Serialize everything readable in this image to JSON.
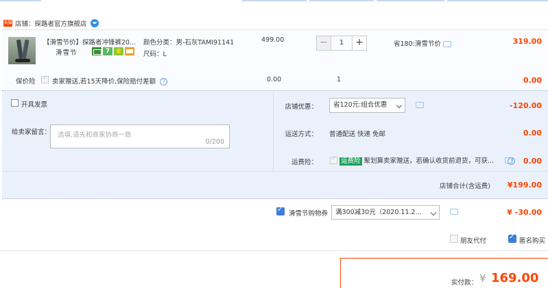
{
  "shop": {
    "badge": "天猫",
    "label": "店铺：探路者官方旗舰店"
  },
  "item": {
    "title": "【滑雪节价】探路者冲锋裤20...",
    "promo": "滑雪节",
    "spec_color": "颜色分类：男-石灰TAMI91141",
    "spec_size": "尺码：L",
    "unit_price": "499.00",
    "quantity": "1",
    "discount_note": "省180:滑雪节价",
    "subtotal": "319.00",
    "icons": [
      "card-icon",
      "seven-day-return-icon",
      "gold-badge-icon",
      "wallet-icon"
    ]
  },
  "insurance": {
    "label": "保价险",
    "text": "卖家赠送,若15天降价,保险赔付差额",
    "price": "0.00",
    "qty": "1",
    "total": "0.00"
  },
  "invoice": {
    "label": "开具发票"
  },
  "message": {
    "label": "给卖家留言：",
    "placeholder": "选填,请先和商家协商一致",
    "count": "0/200"
  },
  "shop_discount": {
    "label": "店铺优惠：",
    "selected": "省120元:组合优惠",
    "amount": "-120.00"
  },
  "shipping": {
    "label": "运送方式：",
    "value": "普通配送 快递 免邮",
    "amount": "0.00"
  },
  "shipping_insurance": {
    "label": "运费险：",
    "tag": "运费险",
    "text": "聚划算卖家赠送，若确认收货前退货，可获...",
    "amount": "0.00"
  },
  "shop_total": {
    "label": "店铺合计(含运费)",
    "amount": "¥199.00"
  },
  "voucher": {
    "label": "滑雪节购物券",
    "selected": "满300减30元（2020.11.2...",
    "amount": "¥ -30.00"
  },
  "friend_pay": {
    "label": "朋友代付"
  },
  "anonymous": {
    "label": "匿名购买"
  },
  "payment": {
    "label": "实付款：",
    "currency": "¥",
    "amount": "169.00"
  },
  "colors": {
    "accent": "#ff4400",
    "panel": "#eaf1fb",
    "checkbox": "#3b7fd6"
  }
}
